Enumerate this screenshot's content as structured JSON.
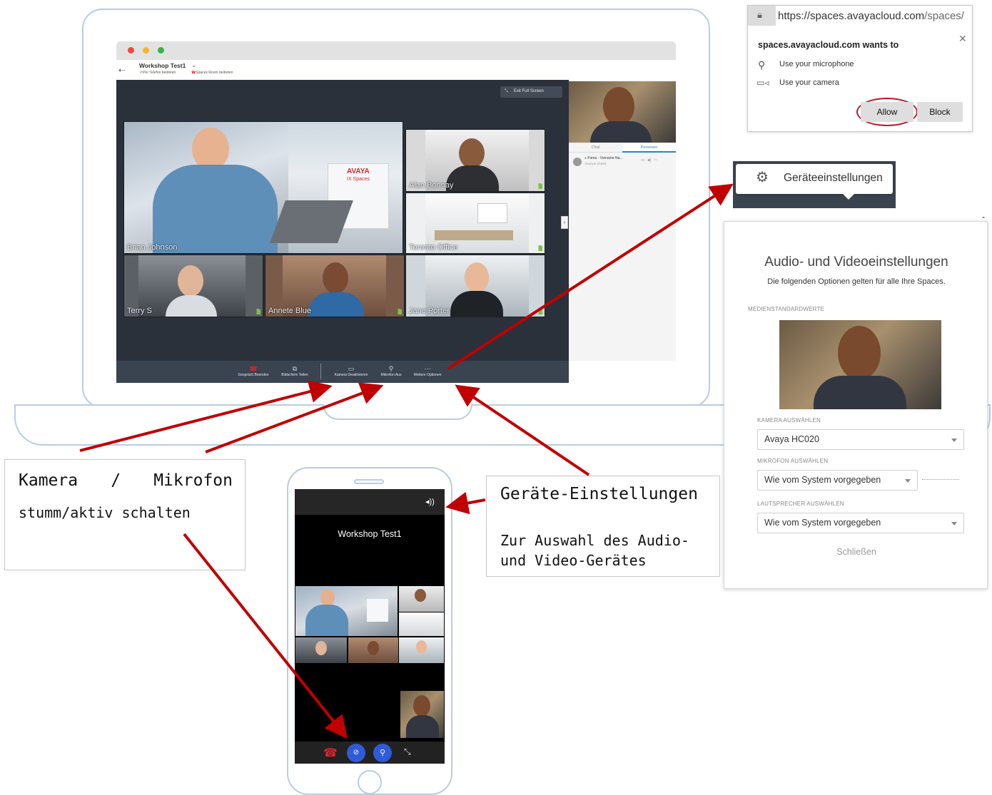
{
  "laptop": {
    "app_title": "Workshop Test1",
    "join_phone": "Per Telefon beitreten",
    "join_room": "Spaces Room beitreten",
    "exit_full_screen": "Exit Full Screen",
    "participants": [
      "Brian Johnson",
      "Alan Bonnay",
      "Toronto Office",
      "Terry S",
      "Annete Blue",
      "Jane Porter"
    ],
    "logo_line1": "AVAYA",
    "logo_line2": "IX Spaces",
    "side_tabs": [
      "Chat",
      "Personen"
    ],
    "side_person": "Firma - Vorname Na...",
    "side_person_sub": "Anonym (Gast)",
    "toolbar": {
      "end_call": "Gespräch Beenden",
      "share_screen": "Bildschirm Teilen",
      "camera_off": "Kamera Deaktivieren",
      "mic_off": "Mikrofon Aus",
      "more_options": "Weitere Optionen"
    }
  },
  "notes": {
    "camera_mic_line1_a": "Kamera",
    "camera_mic_line1_b": "/",
    "camera_mic_line1_c": "Mikrofon",
    "camera_mic_line2": "stumm/aktiv schalten",
    "devices_title": "Geräte-Einstellungen",
    "devices_text": "Zur Auswahl des Audio- und Video-Gerätes"
  },
  "phone": {
    "title": "Workshop Test1"
  },
  "permission": {
    "url_prefix": "https://spaces.avayacloud.com",
    "url_suffix": "/spaces/",
    "title": "spaces.avayacloud.com wants to",
    "item_mic": "Use your microphone",
    "item_camera": "Use your camera",
    "allow": "Allow",
    "block": "Block"
  },
  "gear_popup": {
    "label": "Geräteeinstellungen"
  },
  "settings": {
    "title": "Audio- und Videoeinstellungen",
    "subtitle": "Die folgenden Optionen gelten für alle Ihre Spaces.",
    "section": "MEDIENSTANDARDWERTE",
    "camera_label": "KAMERA AUSWÄHLEN",
    "camera_value": "Avaya HC020",
    "mic_label": "MIKROFON AUSWÄHLEN",
    "mic_value": "Wie vom System vorgegeben",
    "speaker_label": "LAUTSPRECHER AUSWÄHLEN",
    "speaker_value": "Wie vom System vorgegeben",
    "close": "Schließen"
  },
  "colors": {
    "annotation_arrow": "#c00000",
    "allow_highlight": "#b01c2e",
    "mobile_button": "#2f5bd8",
    "end_call": "#e0242a"
  }
}
